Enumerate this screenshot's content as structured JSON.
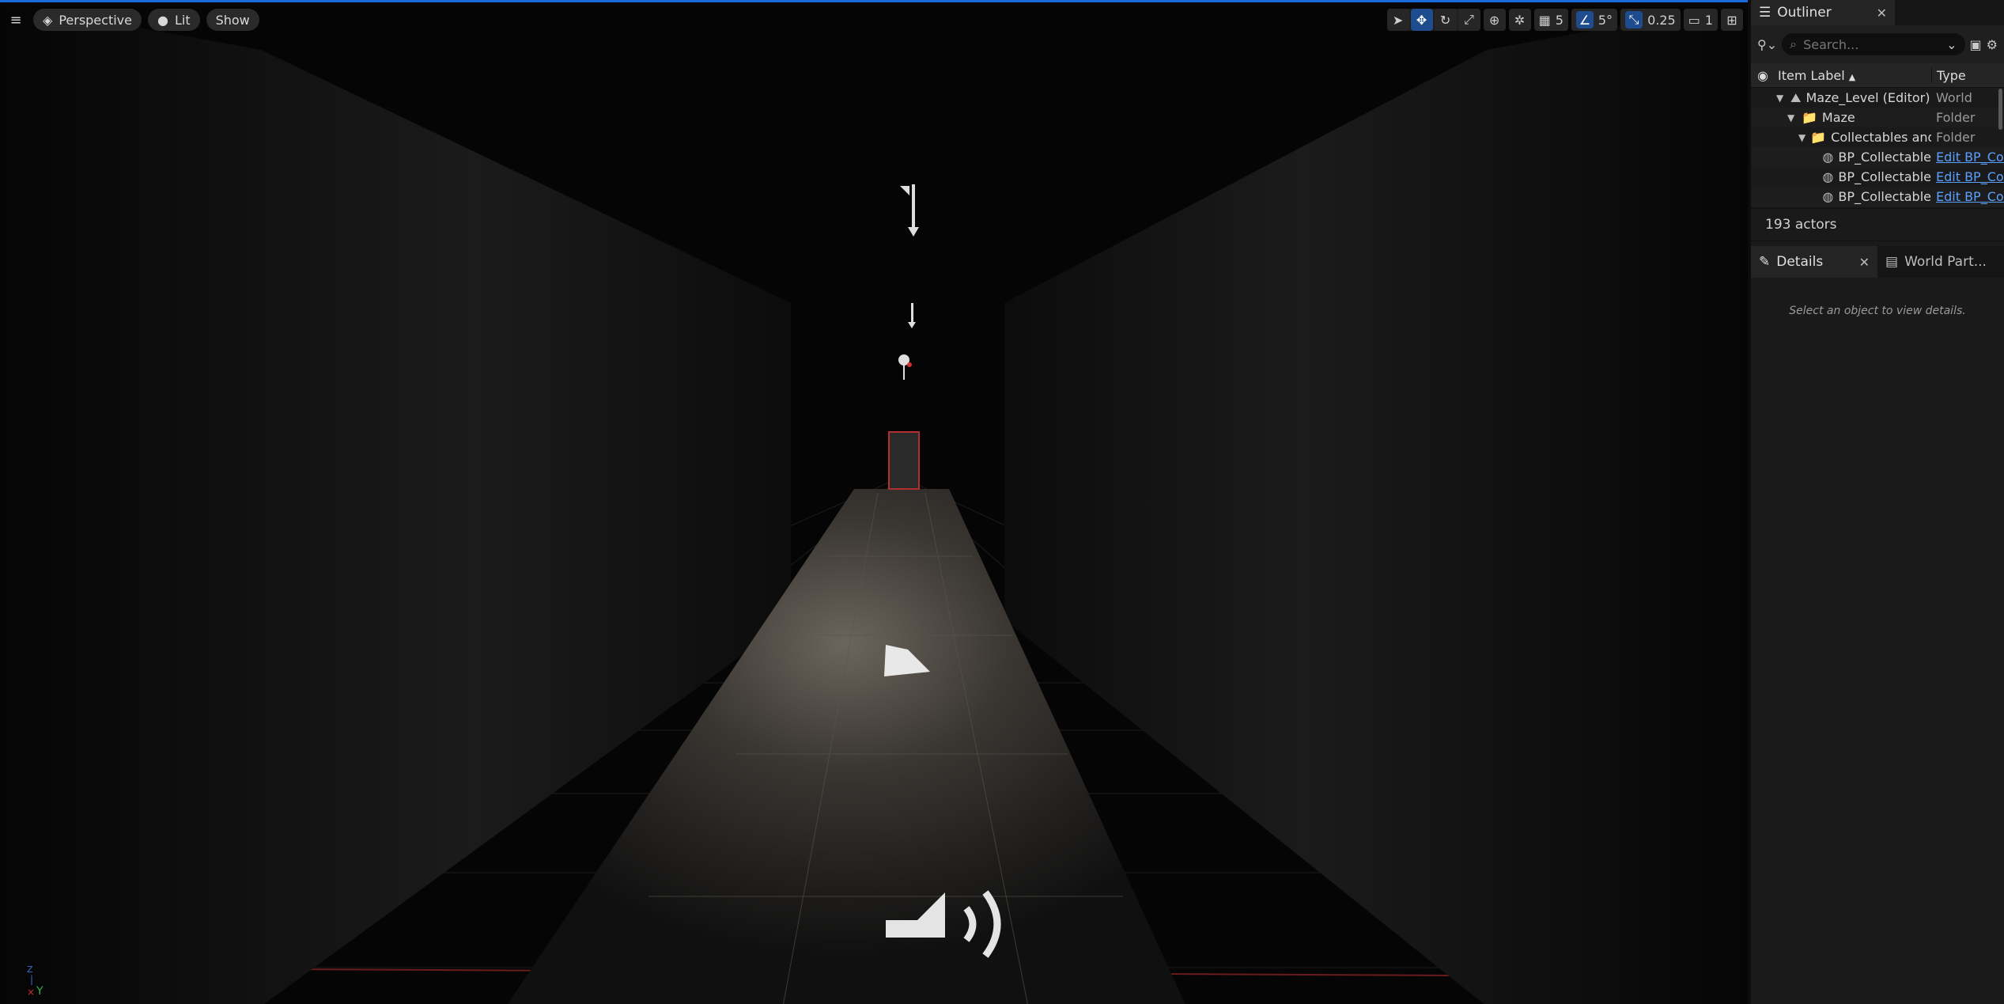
{
  "viewport": {
    "view_mode": "Perspective",
    "lighting_mode": "Lit",
    "show_label": "Show",
    "grid_snap_value": "5",
    "rotation_snap_value": "5°",
    "scale_snap_value": "0.25",
    "camera_speed_value": "1",
    "axis_labels": {
      "z": "Z",
      "y": "Y"
    }
  },
  "outliner": {
    "title": "Outliner",
    "search_placeholder": "Search...",
    "columns": {
      "label": "Item Label",
      "type": "Type"
    },
    "rows": [
      {
        "label": "Maze_Level (Editor)",
        "type": "World",
        "indent": 1,
        "icon": "world-icon",
        "link": false
      },
      {
        "label": "Maze",
        "type": "Folder",
        "indent": 2,
        "icon": "folder-icon",
        "link": false
      },
      {
        "label": "Collectables and",
        "type": "Folder",
        "indent": 3,
        "icon": "folder-icon",
        "link": false
      },
      {
        "label": "BP_Collectable",
        "type": "Edit BP_Collectable",
        "indent": 4,
        "icon": "actor-icon",
        "link": true
      },
      {
        "label": "BP_Collectable",
        "type": "Edit BP_Collectable",
        "indent": 4,
        "icon": "actor-icon",
        "link": true
      },
      {
        "label": "BP_Collectable",
        "type": "Edit BP_Collectable",
        "indent": 4,
        "icon": "actor-icon",
        "link": true
      }
    ],
    "actor_count": "193 actors"
  },
  "details": {
    "tab_details": "Details",
    "tab_world_partition": "World Part...",
    "empty_message": "Select an object to view details."
  },
  "colors": {
    "accent": "#1a6ad9",
    "link": "#5aa0ff",
    "grid_line": "#2a2a2a",
    "axis_red": "#7a1f1f"
  }
}
